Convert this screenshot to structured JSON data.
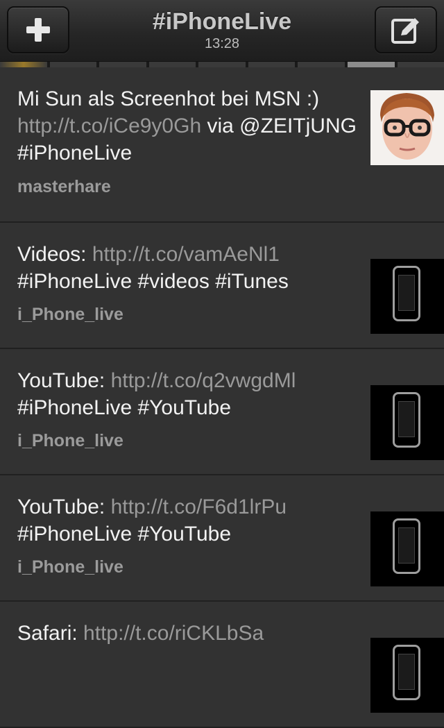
{
  "header": {
    "title": "#iPhoneLive",
    "time": "13:28",
    "left_button_icon": "plus-icon",
    "right_button_icon": "compose-icon"
  },
  "tweets": [
    {
      "text_before": "Mi Sun als Screenhot bei MSN :) ",
      "link": "http://t.co/iCe9y0Gh",
      "text_after": " via @ZEITjUNG #iPhoneLive",
      "user": "masterhare",
      "thumb": "person-photo"
    },
    {
      "text_before": "Videos: ",
      "link": "http://t.co/vamAeNl1",
      "text_after": " #iPhoneLive #videos #iTunes",
      "user": "i_Phone_live",
      "thumb": "phone-icon"
    },
    {
      "text_before": "YouTube: ",
      "link": "http://t.co/q2vwgdMl",
      "text_after": " #iPhoneLive #YouTube",
      "user": "i_Phone_live",
      "thumb": "phone-icon"
    },
    {
      "text_before": "YouTube: ",
      "link": "http://t.co/F6d1lrPu",
      "text_after": " #iPhoneLive #YouTube",
      "user": "i_Phone_live",
      "thumb": "phone-icon"
    },
    {
      "text_before": "Safari: ",
      "link": "http://t.co/riCKLbSa",
      "text_after": "",
      "user": "",
      "thumb": "phone-icon"
    }
  ]
}
